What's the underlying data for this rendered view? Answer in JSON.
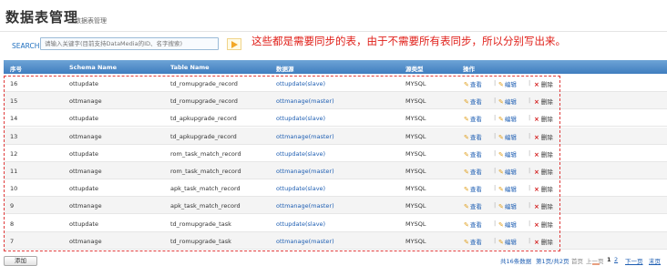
{
  "header": {
    "title": "数据表管理",
    "subtitle": "数据表管理"
  },
  "search": {
    "label": "SEARCH",
    "placeholder": "请输入关键字(目前支持DataMedia的ID、名字搜索)",
    "button_icon": "arrow-right-icon"
  },
  "annotation": "这些都是需要同步的表，由于不需要所有表同步，所以分别写出来。",
  "table": {
    "columns": [
      "序号",
      "Schema Name",
      "Table Name",
      "数据源",
      "源类型",
      "操作"
    ],
    "rows": [
      {
        "id": "16",
        "schema": "ottupdate",
        "table": "td_romupgrade_record",
        "source": "ottupdate(slave)",
        "type": "MYSQL"
      },
      {
        "id": "15",
        "schema": "ottmanage",
        "table": "td_romupgrade_record",
        "source": "ottmanage(master)",
        "type": "MYSQL"
      },
      {
        "id": "14",
        "schema": "ottupdate",
        "table": "td_apkupgrade_record",
        "source": "ottupdate(slave)",
        "type": "MYSQL"
      },
      {
        "id": "13",
        "schema": "ottmanage",
        "table": "td_apkupgrade_record",
        "source": "ottmanage(master)",
        "type": "MYSQL"
      },
      {
        "id": "12",
        "schema": "ottupdate",
        "table": "rom_task_match_record",
        "source": "ottupdate(slave)",
        "type": "MYSQL"
      },
      {
        "id": "11",
        "schema": "ottmanage",
        "table": "rom_task_match_record",
        "source": "ottmanage(master)",
        "type": "MYSQL"
      },
      {
        "id": "10",
        "schema": "ottupdate",
        "table": "apk_task_match_record",
        "source": "ottupdate(slave)",
        "type": "MYSQL"
      },
      {
        "id": "9",
        "schema": "ottmanage",
        "table": "apk_task_match_record",
        "source": "ottmanage(master)",
        "type": "MYSQL"
      },
      {
        "id": "8",
        "schema": "ottupdate",
        "table": "td_romupgrade_task",
        "source": "ottupdate(slave)",
        "type": "MYSQL"
      },
      {
        "id": "7",
        "schema": "ottmanage",
        "table": "td_romupgrade_task",
        "source": "ottmanage(master)",
        "type": "MYSQL"
      }
    ],
    "actions": {
      "view": "查看",
      "edit": "编辑",
      "delete": "删除"
    },
    "icons": {
      "view": "pencil-icon",
      "edit": "pencil-icon",
      "delete": "close-icon"
    }
  },
  "footer": {
    "add_label": "添加",
    "total": "共16条数据",
    "page_info": "第1页/共2页",
    "first": "首页",
    "prev": "上一页",
    "page_current": "1",
    "page_2": "2",
    "next": "下一页",
    "last": "末页"
  },
  "colors": {
    "header_bar": "#3f7dbf",
    "annotation": "#e0201a",
    "link": "#1f5fb3",
    "delete_icon": "#d42020"
  }
}
